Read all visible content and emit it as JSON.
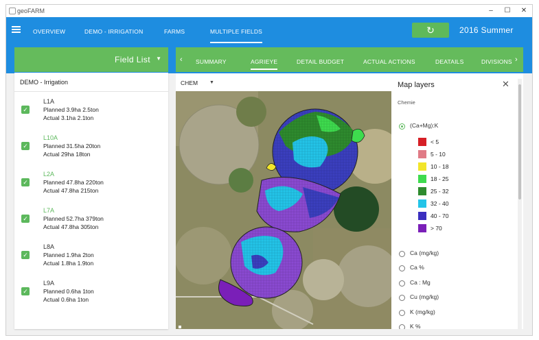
{
  "window": {
    "title": "geoFARM",
    "minimize": "–",
    "maximize": "☐",
    "close": "✕"
  },
  "nav": {
    "items": [
      "OVERVIEW",
      "DEMO - IRRIGATION",
      "FARMS",
      "MULTIPLE FIELDS"
    ],
    "active": 3,
    "season": "2016  Summer",
    "refresh_icon": "↻"
  },
  "field_list": {
    "header": "Field List",
    "dropdown_icon": "▼",
    "group": "DEMO - Irrigation",
    "items": [
      {
        "name": "L1A",
        "planned": "Planned 3.9ha 2.5ton",
        "actual": "Actual 3.1ha 2.1ton",
        "highlight": false
      },
      {
        "name": "L10A",
        "planned": "Planned 31.5ha 20ton",
        "actual": "Actual 29ha 18ton",
        "highlight": true
      },
      {
        "name": "L2A",
        "planned": "Planned 47.8ha 220ton",
        "actual": "Actual 47.8ha 215ton",
        "highlight": true
      },
      {
        "name": "L7A",
        "planned": "Planned 52.7ha 379ton",
        "actual": "Actual 47.8ha 305ton",
        "highlight": true
      },
      {
        "name": "L8A",
        "planned": "Planned 1.9ha 2ton",
        "actual": "Actual 1.8ha 1.9ton",
        "highlight": false
      },
      {
        "name": "L9A",
        "planned": "Planned 0.6ha 1ton",
        "actual": "Actual 0.6ha 1ton",
        "highlight": false
      }
    ]
  },
  "tabs": {
    "items": [
      "SUMMARY",
      "AGRIEYE",
      "DETAIL BUDGET",
      "ACTUAL ACTIONS",
      "DEATAILS",
      "DIVISIONS"
    ],
    "active": 1,
    "prev_icon": "‹",
    "next_icon": "›"
  },
  "layer_select": {
    "value": "CHEM",
    "arrow": "▼"
  },
  "map_layers": {
    "title": "Map layers",
    "close_icon": "✕",
    "section": "Chemie",
    "selected": "(Ca+Mg):K",
    "legend": [
      {
        "label": "< 5",
        "color": "#d61f26"
      },
      {
        "label": "5 - 10",
        "color": "#e07b86"
      },
      {
        "label": "10 - 18",
        "color": "#f2e52a"
      },
      {
        "label": "18 - 25",
        "color": "#3edb4e"
      },
      {
        "label": "25 - 32",
        "color": "#2e8b2e"
      },
      {
        "label": "32 - 40",
        "color": "#23c4e8"
      },
      {
        "label": "40 - 70",
        "color": "#3b2fbf"
      },
      {
        "label": "> 70",
        "color": "#7a1fb8"
      }
    ],
    "options": [
      "Ca (mg/kg)",
      "Ca %",
      "Ca : Mg",
      "Cu (mg/kg)",
      "K (mg/kg)",
      "K %"
    ]
  }
}
